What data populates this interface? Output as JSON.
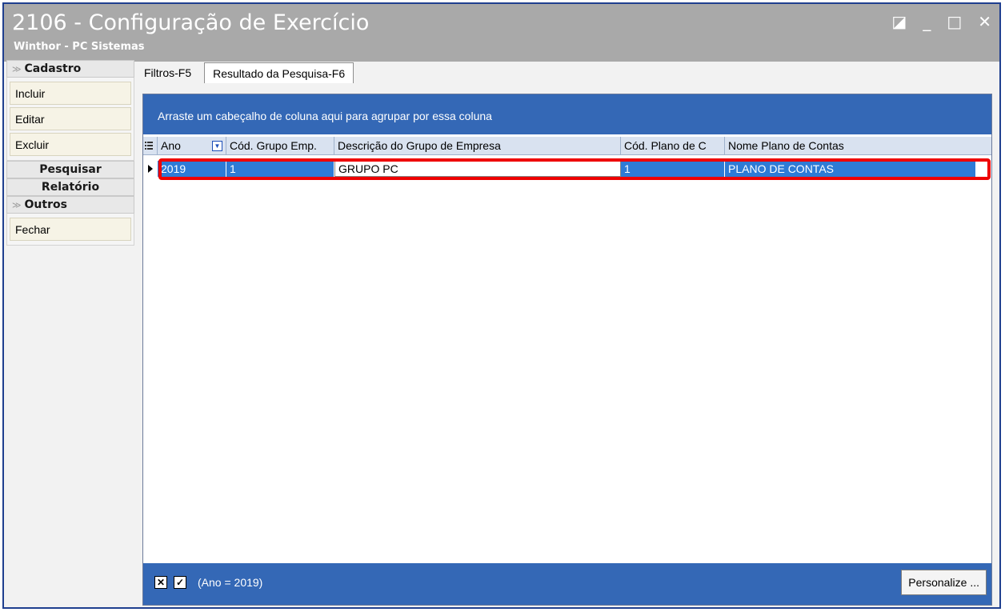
{
  "window": {
    "title": "2106 - Configuração de Exercício",
    "subtitle": "Winthor - PC Sistemas",
    "controls": {
      "restore": "◪",
      "minimize": "_",
      "maximize": "□",
      "close": "✕"
    }
  },
  "sidebar": {
    "cadastro": {
      "title": "Cadastro",
      "items": [
        "Incluir",
        "Editar",
        "Excluir"
      ]
    },
    "pesquisar": "Pesquisar",
    "relatorio": "Relatório",
    "outros": {
      "title": "Outros",
      "items": [
        "Fechar"
      ]
    }
  },
  "tabs": [
    "Filtros-F5",
    "Resultado da Pesquisa-F6"
  ],
  "grid": {
    "group_hint": "Arraste um cabeçalho de coluna aqui para agrupar por essa coluna",
    "columns": [
      "Ano",
      "Cód. Grupo Emp.",
      "Descrição do Grupo de Empresa",
      "Cód. Plano de  C",
      "Nome Plano de Contas"
    ],
    "rows": [
      [
        "2019",
        "1",
        "GRUPO PC",
        "1",
        "PLANO DE CONTAS"
      ]
    ],
    "filter_text": "(Ano = 2019)",
    "personalize_label": "Personalize ..."
  },
  "colors": {
    "accent": "#3468b6",
    "selection": "#2e7bd6",
    "highlight": "#ee0000",
    "titlebar": "#a9a9a9"
  }
}
